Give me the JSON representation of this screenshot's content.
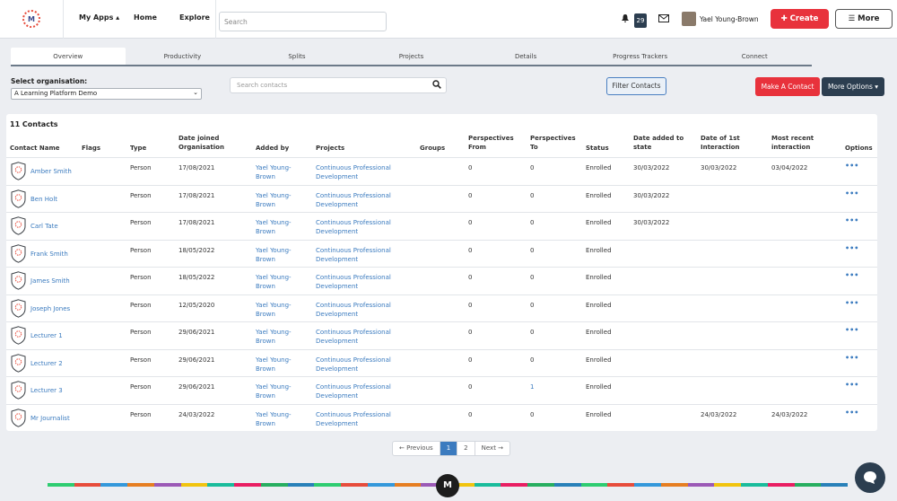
{
  "nav": {
    "logo_letter": "M",
    "my_apps": "My Apps ▴",
    "home": "Home",
    "explore": "Explore",
    "search_placeholder": "Search",
    "notification_count": "29",
    "user_name": "Yael Young-Brown",
    "create_label": "✚ Create",
    "more_label": "☰ More",
    "icons": [
      "bell-icon",
      "mail-icon",
      "avatar",
      "plus-icon",
      "list-icon"
    ]
  },
  "tabs": [
    "Overview",
    "Productivity",
    "Splits",
    "Projects",
    "Details",
    "Progress Trackers",
    "Connect"
  ],
  "toolbar": {
    "org_label": "Select organisation:",
    "org_value": "A Learning Platform Demo",
    "search_placeholder": "Search contacts",
    "filter_label": "Filter Contacts",
    "make_contact_label": "Make A Contact",
    "more_options_label": "More Options ▾"
  },
  "table": {
    "count_label": "11 Contacts",
    "columns": [
      "Contact Name",
      "Flags",
      "Type",
      "Date joined Organisation",
      "Added by",
      "Projects",
      "Groups",
      "Perspectives From",
      "Perspectives To",
      "Status",
      "Date added to state",
      "Date of 1st Interaction",
      "Most recent interaction",
      "Options"
    ],
    "rows": [
      {
        "name": "Amber Smith",
        "type": "Person",
        "joined": "17/08/2021",
        "added_by": "Yael Young-Brown",
        "project": "Continuous Professional Development",
        "p_from": "0",
        "p_to": "0",
        "status": "Enrolled",
        "state_date": "30/03/2022",
        "first": "30/03/2022",
        "recent": "03/04/2022"
      },
      {
        "name": "Ben Holt",
        "type": "Person",
        "joined": "17/08/2021",
        "added_by": "Yael Young-Brown",
        "project": "Continuous Professional Development",
        "p_from": "0",
        "p_to": "0",
        "status": "Enrolled",
        "state_date": "30/03/2022",
        "first": "",
        "recent": ""
      },
      {
        "name": "Carl Tate",
        "type": "Person",
        "joined": "17/08/2021",
        "added_by": "Yael Young-Brown",
        "project": "Continuous Professional Development",
        "p_from": "0",
        "p_to": "0",
        "status": "Enrolled",
        "state_date": "30/03/2022",
        "first": "",
        "recent": ""
      },
      {
        "name": "Frank Smith",
        "type": "Person",
        "joined": "18/05/2022",
        "added_by": "Yael Young-Brown",
        "project": "Continuous Professional Development",
        "p_from": "0",
        "p_to": "0",
        "status": "Enrolled",
        "state_date": "",
        "first": "",
        "recent": ""
      },
      {
        "name": "James Smith",
        "type": "Person",
        "joined": "18/05/2022",
        "added_by": "Yael Young-Brown",
        "project": "Continuous Professional Development",
        "p_from": "0",
        "p_to": "0",
        "status": "Enrolled",
        "state_date": "",
        "first": "",
        "recent": ""
      },
      {
        "name": "Joseph Jones",
        "type": "Person",
        "joined": "12/05/2020",
        "added_by": "Yael Young-Brown",
        "project": "Continuous Professional Development",
        "p_from": "0",
        "p_to": "0",
        "status": "Enrolled",
        "state_date": "",
        "first": "",
        "recent": ""
      },
      {
        "name": "Lecturer 1",
        "type": "Person",
        "joined": "29/06/2021",
        "added_by": "Yael Young-Brown",
        "project": "Continuous Professional Development",
        "p_from": "0",
        "p_to": "0",
        "status": "Enrolled",
        "state_date": "",
        "first": "",
        "recent": ""
      },
      {
        "name": "Lecturer 2",
        "type": "Person",
        "joined": "29/06/2021",
        "added_by": "Yael Young-Brown",
        "project": "Continuous Professional Development",
        "p_from": "0",
        "p_to": "0",
        "status": "Enrolled",
        "state_date": "",
        "first": "",
        "recent": ""
      },
      {
        "name": "Lecturer 3",
        "type": "Person",
        "joined": "29/06/2021",
        "added_by": "Yael Young-Brown",
        "project": "Continuous Professional Development",
        "p_from": "0",
        "p_to": "1",
        "status": "Enrolled",
        "state_date": "",
        "first": "",
        "recent": ""
      },
      {
        "name": "Mr Journalist",
        "type": "Person",
        "joined": "24/03/2022",
        "added_by": "Yael Young-Brown",
        "project": "Continuous Professional Development",
        "p_from": "0",
        "p_to": "0",
        "status": "Enrolled",
        "state_date": "",
        "first": "24/03/2022",
        "recent": "24/03/2022"
      }
    ],
    "options_glyph": "•••"
  },
  "pagination": {
    "prev": "← Previous",
    "pages": [
      "1",
      "2"
    ],
    "current": "1",
    "next": "Next →"
  },
  "footer": {
    "logo_letter": "M"
  },
  "colors": {
    "accent_red": "#e8323c",
    "dark_navy": "#2c3e50",
    "link_blue": "#3b7bbf",
    "stripe": [
      "#2ecc71",
      "#e74c3c",
      "#3498db",
      "#e67e22",
      "#9b59b6",
      "#f1c40f",
      "#1abc9c",
      "#e91e63",
      "#27ae60",
      "#2980b9"
    ]
  }
}
